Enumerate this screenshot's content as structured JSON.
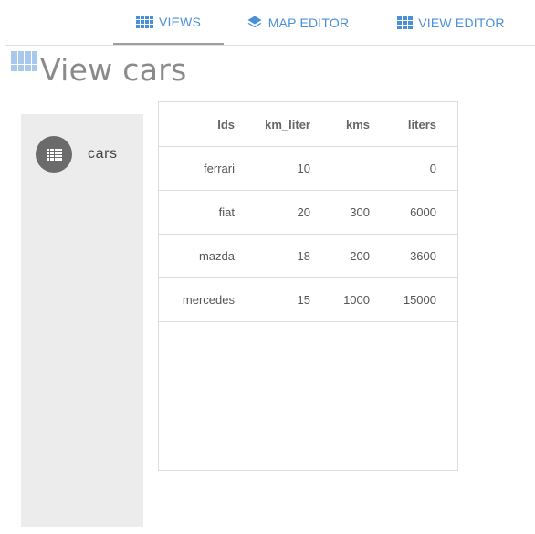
{
  "tabs": [
    {
      "label": "VIEWS",
      "icon": "grid-icon",
      "active": true
    },
    {
      "label": "MAP EDITOR",
      "icon": "layers-icon",
      "active": false
    },
    {
      "label": "VIEW EDITOR",
      "icon": "grid-icon",
      "active": false
    }
  ],
  "page": {
    "title": "View cars",
    "title_icon": "grid-icon"
  },
  "sidebar": {
    "items": [
      {
        "label": "cars",
        "icon": "grid-icon"
      }
    ]
  },
  "table": {
    "columns": [
      "Ids",
      "km_liter",
      "kms",
      "liters"
    ],
    "rows": [
      [
        "ferrari",
        "10",
        "",
        "0"
      ],
      [
        "fiat",
        "20",
        "300",
        "6000"
      ],
      [
        "mazda",
        "18",
        "200",
        "3600"
      ],
      [
        "mercedes",
        "15",
        "1000",
        "15000"
      ]
    ]
  },
  "colors": {
    "accent": "#4a90d9",
    "title_icon": "#a8c8ec",
    "tab_underline": "#9e9e9e",
    "sidebar_bg": "#ececec",
    "avatar_bg": "#6b6b6b"
  }
}
